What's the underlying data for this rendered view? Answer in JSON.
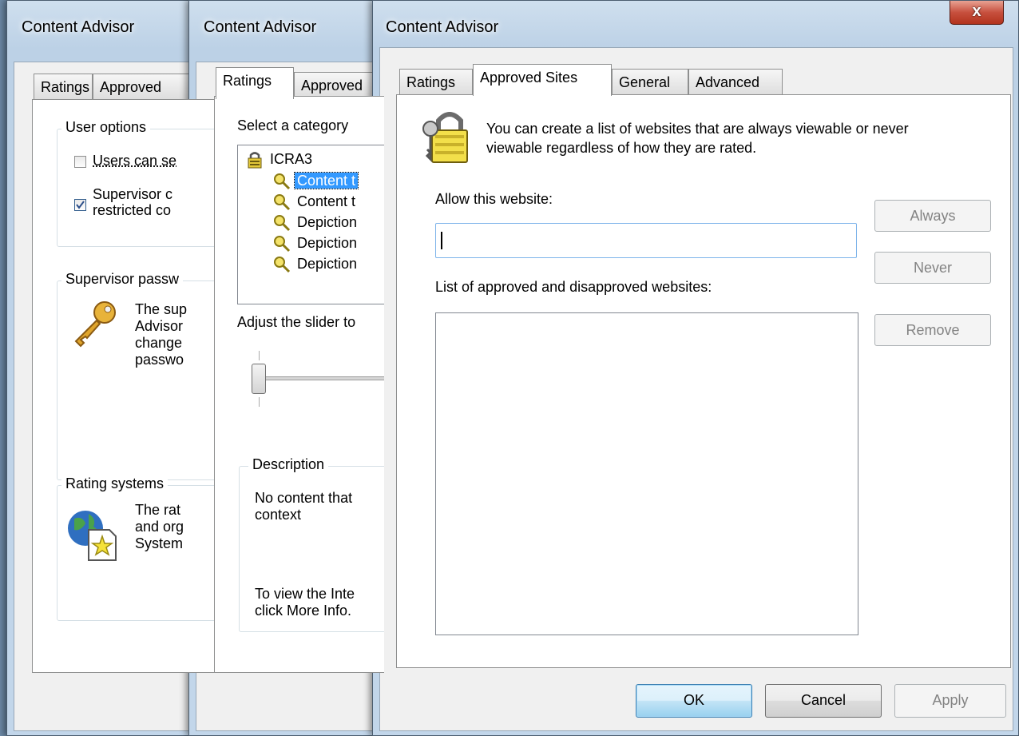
{
  "window_left": {
    "title": "Content Advisor",
    "tabs": [
      "Ratings",
      "Approved"
    ],
    "user_options": {
      "heading": "User options",
      "checkbox1_label": "Users can se",
      "checkbox2_line1": "Supervisor c",
      "checkbox2_line2": "restricted co"
    },
    "supervisor_password": {
      "heading": "Supervisor passw",
      "lines": [
        "The sup",
        "Advisor",
        "change",
        "passwo"
      ]
    },
    "rating_systems": {
      "heading": "Rating systems",
      "lines": [
        "The rat",
        "and org",
        "System"
      ]
    }
  },
  "window_middle": {
    "title": "Content Advisor",
    "tabs": [
      "Ratings",
      "Approved"
    ],
    "select_category_label": "Select a category",
    "tree": {
      "root": "ICRA3",
      "items": [
        "Content t",
        "Content t",
        "Depiction",
        "Depiction",
        "Depiction"
      ]
    },
    "slider_label": "Adjust the slider to",
    "description": {
      "heading": "Description",
      "text_line1": "No content that",
      "text_line2": "context",
      "info_line1": "To view the Inte",
      "info_line2": "click More Info."
    }
  },
  "window_right": {
    "title": "Content Advisor",
    "close_glyph": "x",
    "tabs": [
      "Ratings",
      "Approved Sites",
      "General",
      "Advanced"
    ],
    "intro_line1": "You can create a list of websites that are always viewable or never",
    "intro_line2": "viewable regardless of how they are rated.",
    "allow_label": "Allow this website:",
    "allow_input_value": "",
    "list_label": "List of approved and disapproved websites:",
    "buttons": {
      "always": "Always",
      "never": "Never",
      "remove": "Remove",
      "ok": "OK",
      "cancel": "Cancel",
      "apply": "Apply"
    }
  },
  "colors": {
    "selection": "#3399ff",
    "close_button": "#c7503e",
    "default_button_border": "#3c7fb1"
  },
  "icons": [
    "key-icon",
    "globe-document-icon",
    "ratings-lock-icon",
    "magnifier-key-icon",
    "padlock-key-icon",
    "close-icon"
  ]
}
